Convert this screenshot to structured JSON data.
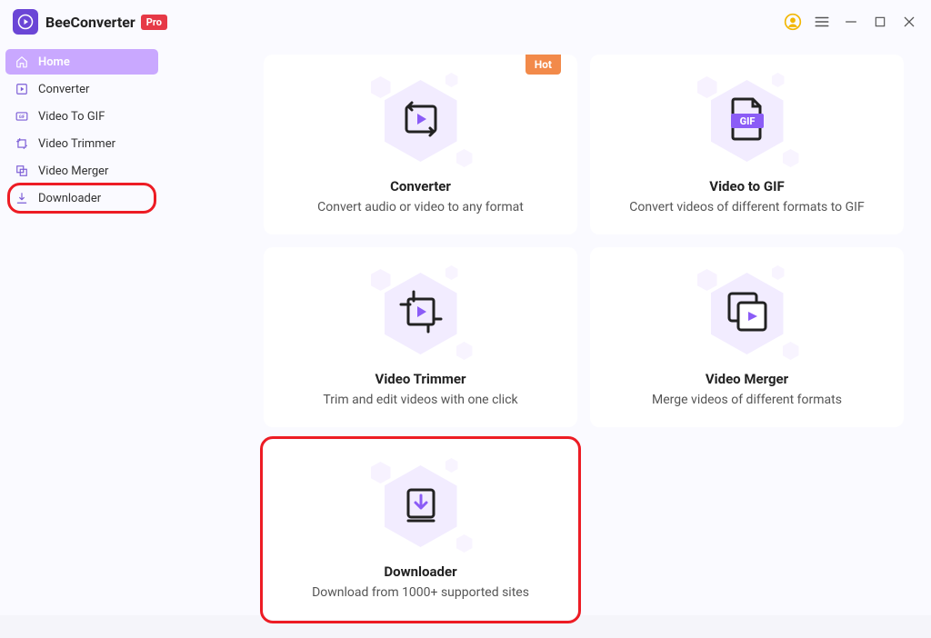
{
  "header": {
    "app_name": "BeeConverter",
    "pro_label": "Pro"
  },
  "sidebar": {
    "items": [
      {
        "label": "Home",
        "icon": "home-icon"
      },
      {
        "label": "Converter",
        "icon": "play-box-icon"
      },
      {
        "label": "Video To GIF",
        "icon": "gif-icon"
      },
      {
        "label": "Video Trimmer",
        "icon": "trim-icon"
      },
      {
        "label": "Video Merger",
        "icon": "merge-icon"
      },
      {
        "label": "Downloader",
        "icon": "download-icon"
      }
    ]
  },
  "cards": [
    {
      "title": "Converter",
      "desc": "Convert audio or video to any format",
      "hot": "Hot"
    },
    {
      "title": "Video to GIF",
      "desc": "Convert videos of different formats to GIF"
    },
    {
      "title": "Video Trimmer",
      "desc": "Trim and edit videos with one click"
    },
    {
      "title": "Video Merger",
      "desc": "Merge videos of different formats"
    },
    {
      "title": "Downloader",
      "desc": "Download from 1000+ supported sites"
    }
  ]
}
